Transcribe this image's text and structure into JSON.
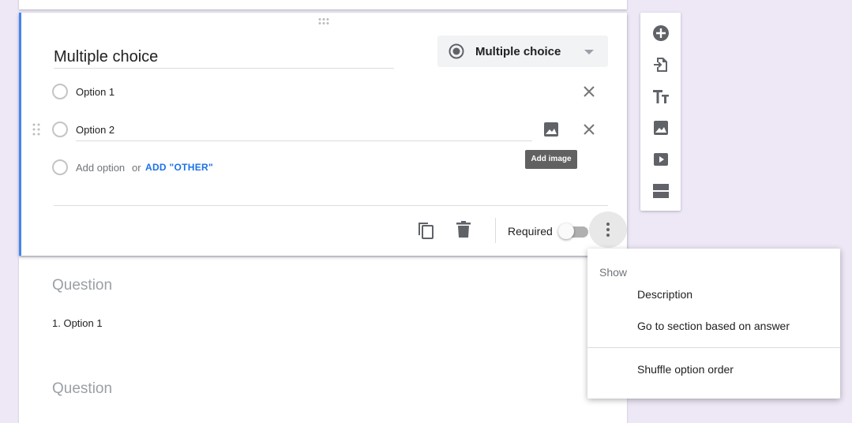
{
  "question": {
    "title": "Multiple choice",
    "type_label": "Multiple choice",
    "options": [
      "Option 1",
      "Option 2"
    ],
    "add_option": "Add option",
    "add_or": "or",
    "add_other": "ADD \"OTHER\"",
    "tooltip_add_image": "Add image",
    "required_label": "Required",
    "required": false
  },
  "lower": {
    "question_placeholder": "Question",
    "option_1": "1.  Option 1",
    "question_placeholder_2": "Question"
  },
  "menu": {
    "header": "Show",
    "items": [
      "Description",
      "Go to section based on answer",
      "Shuffle option order"
    ]
  },
  "toolbar": {
    "icons": [
      "add-question-icon",
      "import-questions-icon",
      "add-title-icon",
      "add-image-icon",
      "add-video-icon",
      "add-section-icon"
    ]
  },
  "colors": {
    "accent": "#4285f4",
    "background": "#ede7f6",
    "link": "#1a73e8"
  }
}
